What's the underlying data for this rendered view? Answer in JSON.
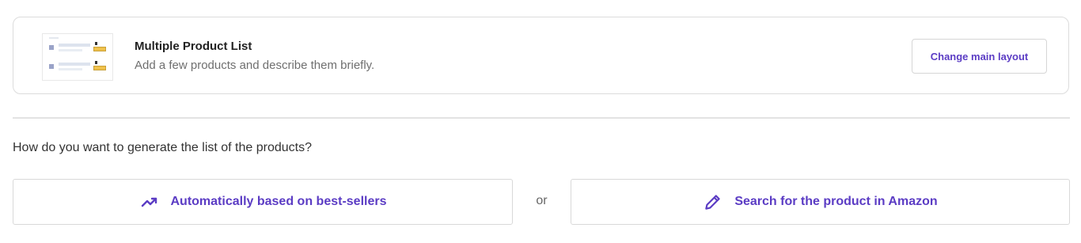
{
  "layout_card": {
    "title": "Multiple Product List",
    "subtitle": "Add a few products and describe them briefly.",
    "change_button_label": "Change main layout"
  },
  "question": "How do you want to generate the list of the products?",
  "options": {
    "auto_label": "Automatically based on best-sellers",
    "or_label": "or",
    "search_label": "Search for the product in Amazon",
    "auto_icon": "trending-up-icon",
    "search_icon": "pencil-icon"
  },
  "colors": {
    "accent": "#5b3cc4",
    "border": "#d9d9d9"
  }
}
